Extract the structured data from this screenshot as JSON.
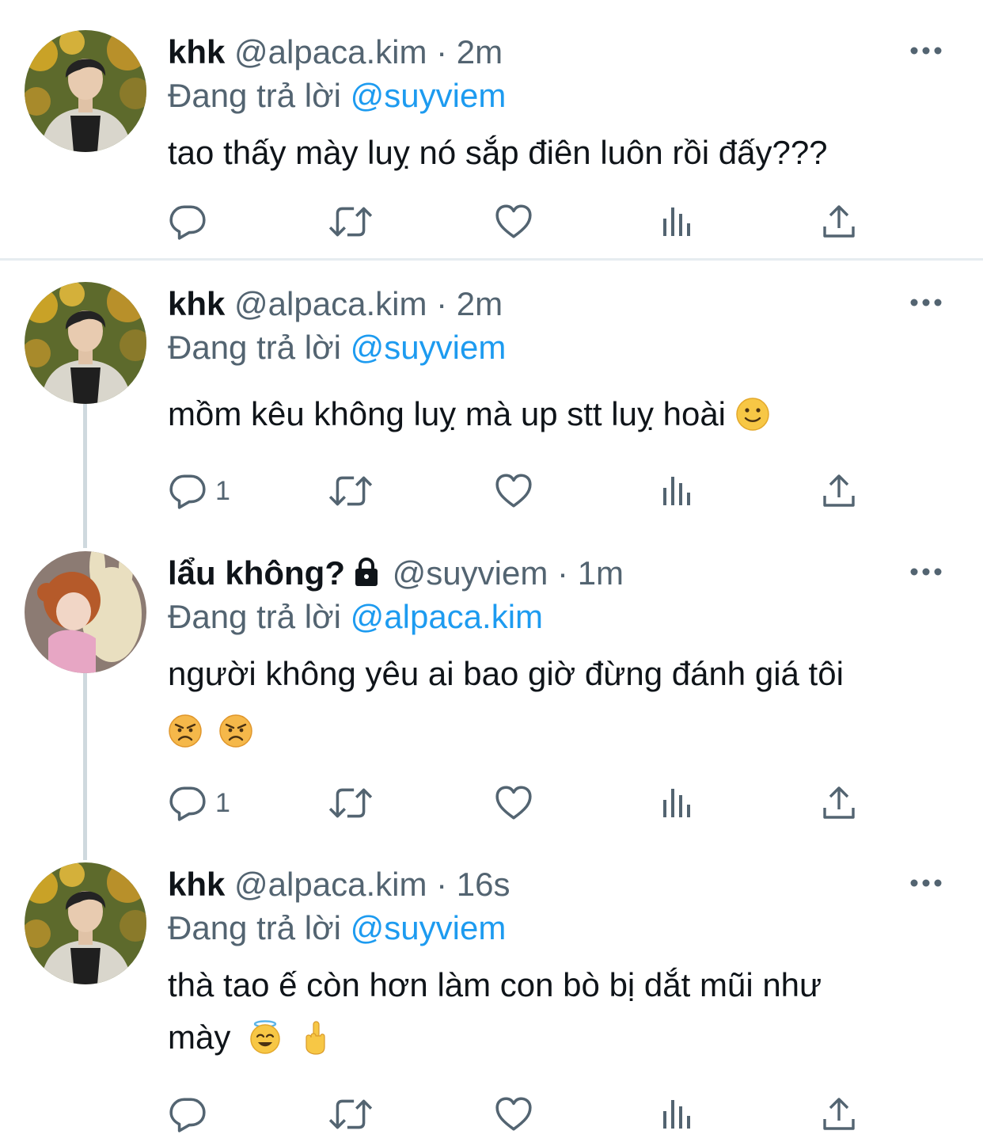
{
  "colors": {
    "text": "#0f1419",
    "muted": "#536471",
    "accent": "#1d9bf0",
    "divider": "#e6ecf0"
  },
  "tweets": [
    {
      "name": "khk",
      "handle": "@alpaca.kim",
      "time": "2m",
      "reply_prefix": "Đang trả lời",
      "reply_to": "@suyviem",
      "text": "tao thấy mày luỵ nó sắp điên luôn rồi đấy???",
      "emojis": [],
      "reply_count": ""
    },
    {
      "name": "khk",
      "handle": "@alpaca.kim",
      "time": "2m",
      "reply_prefix": "Đang trả lời",
      "reply_to": "@suyviem",
      "text": "mồm kêu không luỵ mà up stt luỵ hoài",
      "emojis": [
        "slightly-smiling-face"
      ],
      "reply_count": "1"
    },
    {
      "name": "lẩu không?",
      "handle": "@suyviem",
      "time": "1m",
      "reply_prefix": "Đang trả lời",
      "reply_to": "@alpaca.kim",
      "text": "người không yêu ai bao giờ đừng đánh giá tôi",
      "emojis": [
        "angry-face",
        "angry-face"
      ],
      "reply_count": "1"
    },
    {
      "name": "khk",
      "handle": "@alpaca.kim",
      "time": "16s",
      "reply_prefix": "Đang trả lời",
      "reply_to": "@suyviem",
      "text_line1": "thà tao ế còn hơn làm con bò bị dắt mũi như",
      "text_line2": "mày",
      "emojis": [
        "smiling-face-with-halo",
        "middle-finger"
      ],
      "reply_count": ""
    }
  ],
  "separator": "·",
  "icons": [
    "reply-icon",
    "retweet-icon",
    "like-icon",
    "views-icon",
    "share-icon",
    "more-icon",
    "lock-icon"
  ]
}
